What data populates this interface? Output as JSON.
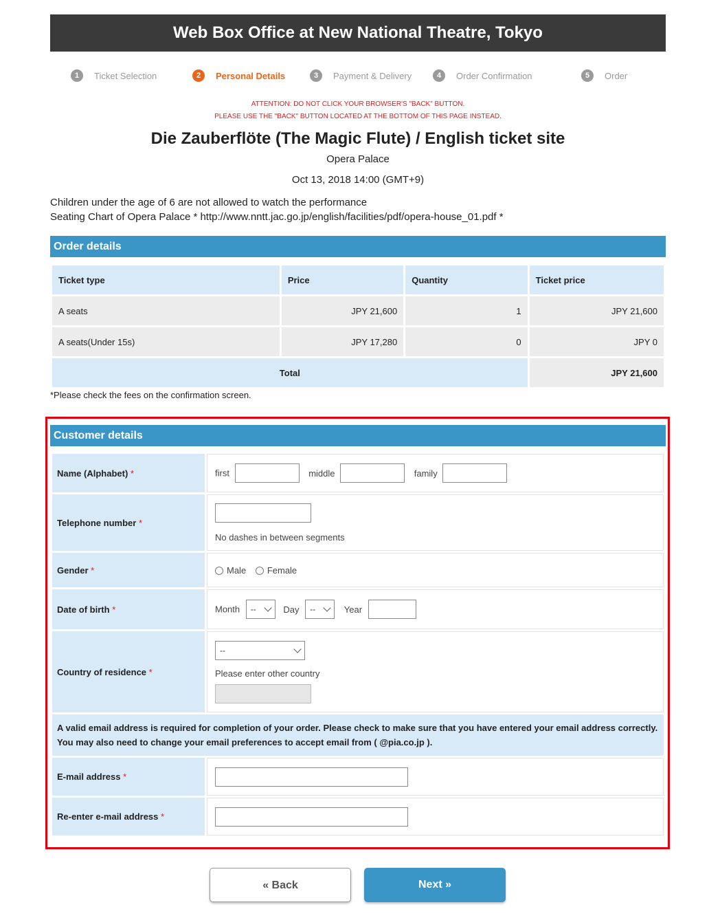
{
  "header": {
    "title": "Web Box Office at New National Theatre, Tokyo"
  },
  "steps": [
    {
      "num": "1",
      "label": "Ticket Selection"
    },
    {
      "num": "2",
      "label": "Personal Details"
    },
    {
      "num": "3",
      "label": "Payment & Delivery"
    },
    {
      "num": "4",
      "label": "Order Confirmation"
    },
    {
      "num": "5",
      "label": "Order"
    }
  ],
  "attention": {
    "line1": "ATTENTION: DO NOT CLICK YOUR BROWSER'S \"BACK\" BUTTON.",
    "line2": "PLEASE USE THE \"BACK\" BUTTON LOCATED AT THE BOTTOM OF THIS PAGE INSTEAD."
  },
  "event": {
    "title": "Die Zauberflöte (The Magic Flute) / English ticket site",
    "venue": "Opera Palace",
    "datetime": "Oct 13, 2018 14:00  (GMT+9)",
    "note1": "Children under the age of 6 are not allowed to watch the performance",
    "note2": "Seating Chart of Opera Palace * http://www.nntt.jac.go.jp/english/facilities/pdf/opera-house_01.pdf *"
  },
  "order": {
    "heading": "Order details",
    "columns": [
      "Ticket type",
      "Price",
      "Quantity",
      "Ticket price"
    ],
    "rows": [
      {
        "type": "A seats",
        "price": "JPY  21,600",
        "qty": "1",
        "total": "JPY  21,600"
      },
      {
        "type": "A seats(Under 15s)",
        "price": "JPY  17,280",
        "qty": "0",
        "total": "JPY  0"
      }
    ],
    "total_label": "Total",
    "total_value": "JPY  21,600",
    "fee_note": "*Please check the fees on the confirmation screen."
  },
  "customer": {
    "heading": "Customer details",
    "name_label": "Name (Alphabet)",
    "name_first": "first",
    "name_middle": "middle",
    "name_family": "family",
    "phone_label": "Telephone number",
    "phone_hint": "No dashes in between segments",
    "gender_label": "Gender",
    "gender_male": "Male",
    "gender_female": "Female",
    "dob_label": "Date of birth",
    "dob_month": "Month",
    "dob_day": "Day",
    "dob_year": "Year",
    "dob_month_value": "--",
    "dob_day_value": "--",
    "country_label": "Country of residence",
    "country_value": "--",
    "country_other_hint": "Please enter other country",
    "email_notice": "A valid email address is required for completion of your order. Please check to make sure that you have entered your email address correctly. You may also need to change your email preferences to accept email from ( @pia.co.jp ).",
    "email_label": "E-mail address",
    "email2_label": "Re-enter e-mail address",
    "required_mark": "*"
  },
  "buttons": {
    "back": "« Back",
    "next": "Next »"
  },
  "colors": {
    "header_bg": "#3a3a3a",
    "accent": "#3b96c8",
    "active_step": "#e8661a",
    "alert": "#e21b1b",
    "highlight_frame": "#e5000f"
  }
}
